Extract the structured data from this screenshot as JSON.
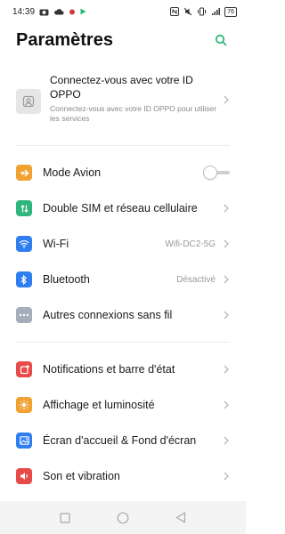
{
  "status_bar": {
    "time": "14:39",
    "battery": "76"
  },
  "header": {
    "title": "Paramètres"
  },
  "account": {
    "title": "Connectez-vous avec votre ID OPPO",
    "subtitle": "Connectez-vous avec votre ID OPPO pour utiliser les services"
  },
  "rows": [
    {
      "label": "Mode Avion",
      "value": "",
      "icon": "airplane-icon",
      "color": "#f0a131"
    },
    {
      "label": "Double SIM et réseau cellulaire",
      "value": "",
      "icon": "sim-icon",
      "color": "#2fb67a"
    },
    {
      "label": "Wi-Fi",
      "value": "Wifi-DC2-5G",
      "icon": "wifi-icon",
      "color": "#2f7ef0"
    },
    {
      "label": "Bluetooth",
      "value": "Désactivé",
      "icon": "bluetooth-icon",
      "color": "#2f7ef0"
    },
    {
      "label": "Autres connexions sans fil",
      "value": "",
      "icon": "more-connections-icon",
      "color": "#8f97a6"
    },
    {
      "label": "Notifications et barre d'état",
      "value": "",
      "icon": "notifications-icon",
      "color": "#e84a4a"
    },
    {
      "label": "Affichage et luminosité",
      "value": "",
      "icon": "brightness-icon",
      "color": "#f0a131"
    },
    {
      "label": "Écran d'accueil & Fond d'écran",
      "value": "",
      "icon": "wallpaper-icon",
      "color": "#2f7ef0"
    },
    {
      "label": "Son et vibration",
      "value": "",
      "icon": "sound-icon",
      "color": "#e84a4a"
    }
  ],
  "airplane_mode_on": false,
  "accent_color": "#2fb67a"
}
